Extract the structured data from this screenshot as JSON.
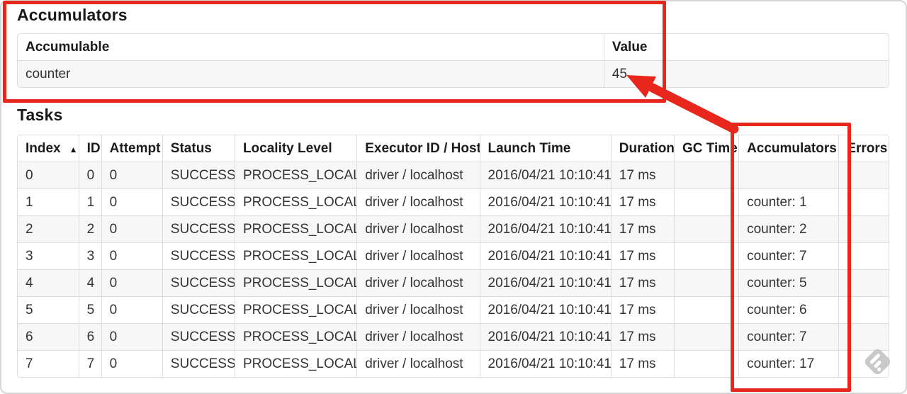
{
  "colors": {
    "annotation_red": "#e8271c",
    "stripe": "#f7f7f7",
    "table_border": "#dddddd"
  },
  "accumulators_section": {
    "title": "Accumulators",
    "columns": [
      "Accumulable",
      "Value"
    ],
    "rows": [
      {
        "accumulable": "counter",
        "value": "45"
      }
    ]
  },
  "tasks_section": {
    "title": "Tasks",
    "sort_icon": "▲",
    "columns": [
      "Index",
      "ID",
      "Attempt",
      "Status",
      "Locality Level",
      "Executor ID / Host",
      "Launch Time",
      "Duration",
      "GC Time",
      "Accumulators",
      "Errors"
    ],
    "rows": [
      [
        "0",
        "0",
        "0",
        "SUCCESS",
        "PROCESS_LOCAL",
        "driver / localhost",
        "2016/04/21 10:10:41",
        "17 ms",
        "",
        "",
        ""
      ],
      [
        "1",
        "1",
        "0",
        "SUCCESS",
        "PROCESS_LOCAL",
        "driver / localhost",
        "2016/04/21 10:10:41",
        "17 ms",
        "",
        "counter: 1",
        ""
      ],
      [
        "2",
        "2",
        "0",
        "SUCCESS",
        "PROCESS_LOCAL",
        "driver / localhost",
        "2016/04/21 10:10:41",
        "17 ms",
        "",
        "counter: 2",
        ""
      ],
      [
        "3",
        "3",
        "0",
        "SUCCESS",
        "PROCESS_LOCAL",
        "driver / localhost",
        "2016/04/21 10:10:41",
        "17 ms",
        "",
        "counter: 7",
        ""
      ],
      [
        "4",
        "4",
        "0",
        "SUCCESS",
        "PROCESS_LOCAL",
        "driver / localhost",
        "2016/04/21 10:10:41",
        "17 ms",
        "",
        "counter: 5",
        ""
      ],
      [
        "5",
        "5",
        "0",
        "SUCCESS",
        "PROCESS_LOCAL",
        "driver / localhost",
        "2016/04/21 10:10:41",
        "17 ms",
        "",
        "counter: 6",
        ""
      ],
      [
        "6",
        "6",
        "0",
        "SUCCESS",
        "PROCESS_LOCAL",
        "driver / localhost",
        "2016/04/21 10:10:41",
        "17 ms",
        "",
        "counter: 7",
        ""
      ],
      [
        "7",
        "7",
        "0",
        "SUCCESS",
        "PROCESS_LOCAL",
        "driver / localhost",
        "2016/04/21 10:10:41",
        "17 ms",
        "",
        "counter: 17",
        ""
      ]
    ]
  }
}
